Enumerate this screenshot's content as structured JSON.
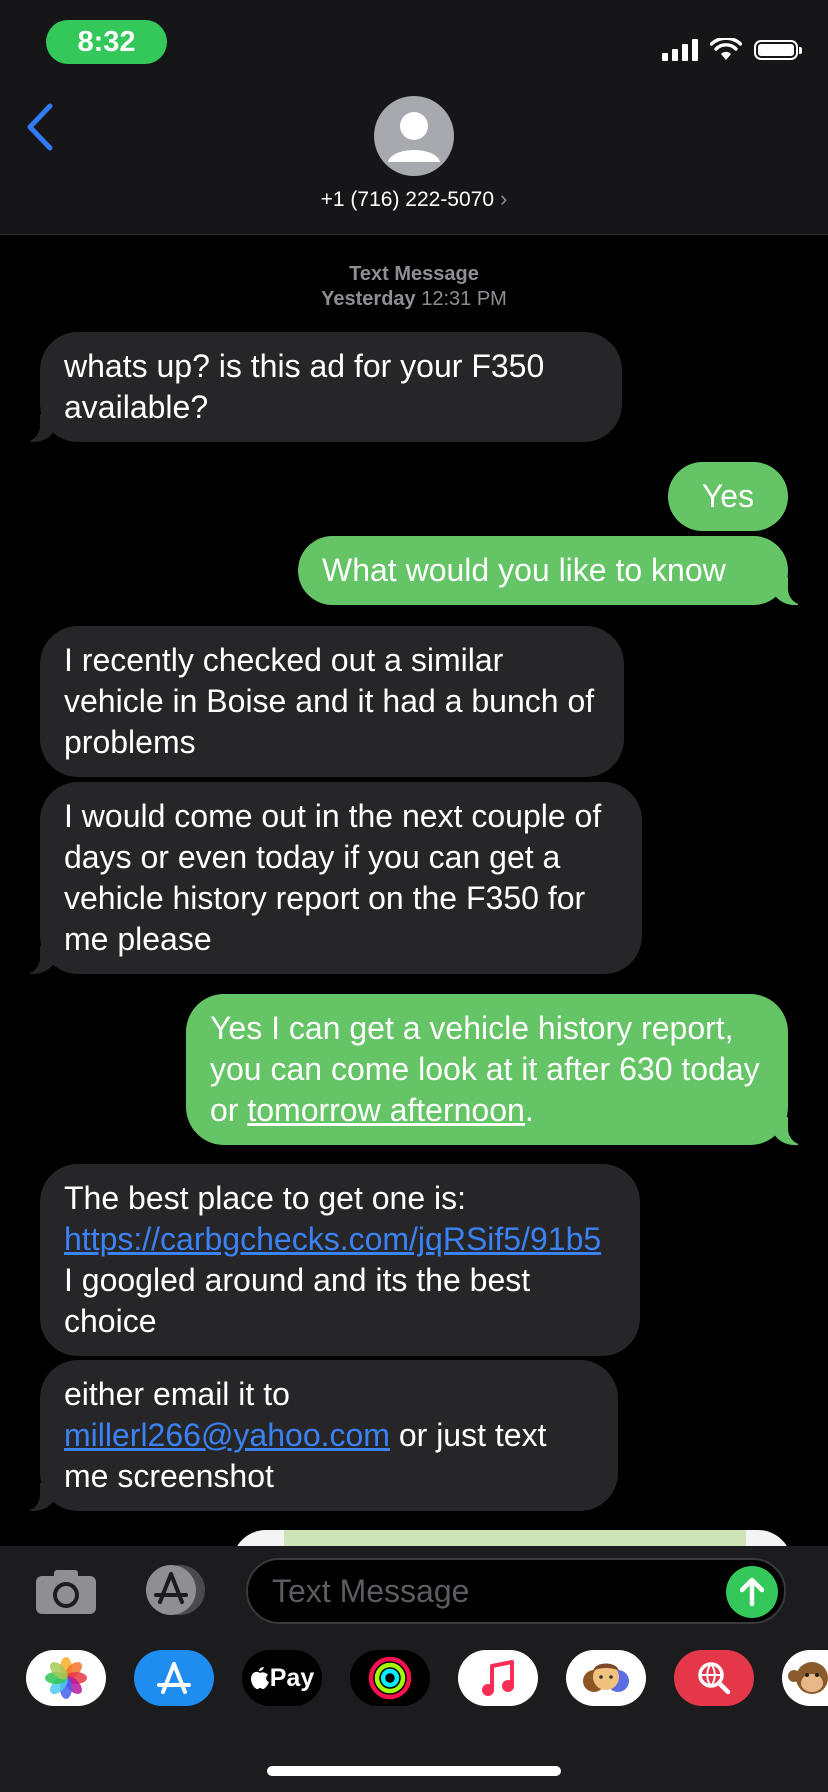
{
  "status": {
    "time": "8:32"
  },
  "header": {
    "contact": "+1 (716) 222-5070",
    "chevron": "›"
  },
  "timestamp": {
    "kind": "Text Message",
    "day": "Yesterday",
    "time": "12:31 PM"
  },
  "messages": {
    "m1": "whats up? is this ad for your F350 available?",
    "m2": "Yes",
    "m3": "What would you like to know",
    "m4": "I recently checked out a similar vehicle in Boise and it had a bunch of problems",
    "m5": "I would come out in the next couple of days or even today if you can get a vehicle history report on the F350 for me please",
    "m6_pre": "Yes I can get a vehicle history report, you can come look at it after 630 today or ",
    "m6_link": "tomorrow afternoon",
    "m6_post": ".",
    "m7_pre": "The best place to get one is: ",
    "m7_link": "https://carbgchecks.com/jqRSif5/91b5",
    "m7_post": " I googled around and its the best choice",
    "m8_pre": "either email it to ",
    "m8_link": "millerl266@yahoo.com",
    "m8_post": " or just text me screenshot"
  },
  "composer": {
    "placeholder": "Text Message"
  },
  "drawer": {
    "applepay_label": "Pay"
  },
  "colors": {
    "incoming": "#262628",
    "outgoing": "#65c466",
    "link": "#3b82f6",
    "accent": "#34c759"
  },
  "icons": [
    "back-chevron-icon",
    "person-icon",
    "camera-icon",
    "app-store-icon",
    "send-arrow-icon",
    "photos-icon",
    "apple-icon",
    "activity-icon",
    "music-icon",
    "memoji-icon",
    "search-web-icon",
    "monkey-icon"
  ]
}
